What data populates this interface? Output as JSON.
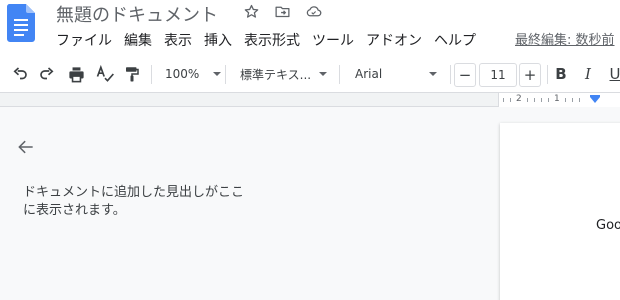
{
  "header": {
    "title": "無題のドキュメント",
    "last_edit": "最終編集: 数秒前"
  },
  "menu": {
    "items": [
      {
        "label": "ファイル"
      },
      {
        "label": "編集"
      },
      {
        "label": "表示"
      },
      {
        "label": "挿入"
      },
      {
        "label": "表示形式"
      },
      {
        "label": "ツール"
      },
      {
        "label": "アドオン"
      },
      {
        "label": "ヘルプ"
      }
    ]
  },
  "toolbar": {
    "zoom": "100%",
    "style": "標準テキス...",
    "font": "Arial",
    "font_size": "11",
    "minus": "−",
    "plus": "+",
    "bold": "B",
    "italic": "I",
    "underline": "U"
  },
  "ruler": {
    "labels": [
      "2",
      "1"
    ]
  },
  "outline": {
    "empty_message": "ドキュメントに追加した見出しがここに表示されます。"
  },
  "document": {
    "visible_text": "Goo"
  },
  "colors": {
    "accent": "#4285f4",
    "doc_icon": "#4285f4"
  }
}
